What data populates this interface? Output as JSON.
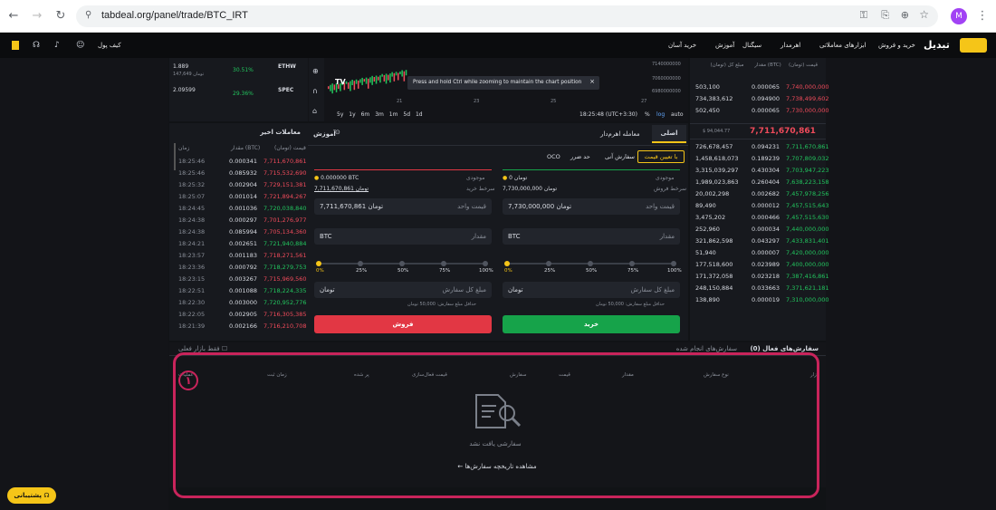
{
  "browser": {
    "url": "tabdeal.org/panel/trade/BTC_IRT",
    "avatar": "M"
  },
  "nav": {
    "logo": "تبدیل",
    "buy_sell": "خرید و فروش",
    "tools": "ابزارهای معاملاتی",
    "leverage": "اهرمدار",
    "signal": "سیگنال",
    "learn": "آموزش",
    "easy": "خرید آسان",
    "wallet": "کیف پول"
  },
  "markets": [
    {
      "name": "ETHW",
      "price": "1.889",
      "sub": "147,649 تومان",
      "change": "30.51%"
    },
    {
      "name": "SPEC",
      "price": "2.09599",
      "sub": "",
      "change": "29.36%"
    }
  ],
  "recent": {
    "title": "معاملات اخیر",
    "headers": [
      "زمان",
      "مقدار (BTC)",
      "قیمت (تومان)"
    ],
    "rows": [
      [
        "18:25:46",
        "0.000341",
        "7,711,670,861",
        "r"
      ],
      [
        "18:25:46",
        "0.085932",
        "7,715,532,690",
        "r"
      ],
      [
        "18:25:32",
        "0.002904",
        "7,729,151,381",
        "r"
      ],
      [
        "18:25:07",
        "0.001014",
        "7,721,894,267",
        "r"
      ],
      [
        "18:24:45",
        "0.001036",
        "7,720,038,840",
        "g"
      ],
      [
        "18:24:38",
        "0.000297",
        "7,701,276,977",
        "r"
      ],
      [
        "18:24:38",
        "0.085994",
        "7,705,134,360",
        "r"
      ],
      [
        "18:24:21",
        "0.002651",
        "7,721,940,884",
        "g"
      ],
      [
        "18:23:57",
        "0.001183",
        "7,718,271,561",
        "r"
      ],
      [
        "18:23:36",
        "0.000792",
        "7,718,279,753",
        "g"
      ],
      [
        "18:23:15",
        "0.003267",
        "7,715,969,560",
        "r"
      ],
      [
        "18:22:51",
        "0.001088",
        "7,718,224,335",
        "g"
      ],
      [
        "18:22:30",
        "0.003000",
        "7,720,952,776",
        "g"
      ],
      [
        "18:22:05",
        "0.002905",
        "7,716,305,385",
        "r"
      ],
      [
        "18:21:39",
        "0.002166",
        "7,716,210,708",
        "r"
      ]
    ]
  },
  "chart": {
    "tooltip": "Press and hold Ctrl while zooming to maintain the chart position",
    "yticks": [
      "7140000000",
      "7060000000",
      "6980000000"
    ],
    "xticks": [
      "21",
      "23",
      "25",
      "27"
    ],
    "ranges": [
      "5y",
      "1y",
      "6m",
      "3m",
      "1m",
      "5d",
      "1d"
    ],
    "time": "18:25:48 (UTC+3:30)",
    "opts": [
      "%",
      "log",
      "auto"
    ]
  },
  "book": {
    "headers": [
      "قیمت (تومان)",
      "مقدار (BTC)",
      "مبلغ کل (تومان)"
    ],
    "asks": [
      [
        "7,740,000,000",
        "0.000065",
        "503,100"
      ],
      [
        "7,738,499,602",
        "0.094900",
        "734,383,612"
      ],
      [
        "7,730,000,000",
        "0.000065",
        "502,450"
      ]
    ],
    "last": "7,711,670,861",
    "last_usd": "$ 94,044.77",
    "bids": [
      [
        "7,711,670,861",
        "0.094231",
        "726,678,457"
      ],
      [
        "7,707,809,032",
        "0.189239",
        "1,458,618,073"
      ],
      [
        "7,703,947,223",
        "0.430304",
        "3,315,039,297"
      ],
      [
        "7,638,223,158",
        "0.260404",
        "1,989,023,863"
      ],
      [
        "7,457,978,256",
        "0.002682",
        "20,002,298"
      ],
      [
        "7,457,515,643",
        "0.000012",
        "89,490"
      ],
      [
        "7,457,515,630",
        "0.000466",
        "3,475,202"
      ],
      [
        "7,440,000,000",
        "0.000034",
        "252,960"
      ],
      [
        "7,433,831,401",
        "0.043297",
        "321,862,598"
      ],
      [
        "7,420,000,000",
        "0.000007",
        "51,940"
      ],
      [
        "7,400,000,000",
        "0.023989",
        "177,518,600"
      ],
      [
        "7,387,416,861",
        "0.023218",
        "171,372,058"
      ],
      [
        "7,371,621,181",
        "0.033663",
        "248,150,884"
      ],
      [
        "7,310,000,000",
        "0.000019",
        "138,890"
      ]
    ]
  },
  "trade": {
    "tab_main": "اصلی",
    "tab_margin": "معامله اهرم‌دار",
    "learn": "آموزش",
    "order_types": [
      "با تعیین قیمت",
      "سفارش آنی",
      "حد ضرر",
      "OCO"
    ],
    "buy": {
      "balance_label": "موجودی",
      "balance": "0 تومان",
      "best_label": "سرخط فروش",
      "best": "7,730,000,000 تومان",
      "price_label": "قیمت واحد",
      "price": "7,730,000,000 تومان",
      "amount_label": "مقدار",
      "asset": "BTC",
      "total_label": "مبلغ کل سفارش",
      "currency": "تومان",
      "min": "حداقل مبلغ سفارش: 50,000 تومان",
      "button": "خرید"
    },
    "sell": {
      "balance_label": "موجودی",
      "balance": "0.000000 BTC",
      "best_label": "سرخط خرید",
      "best": "7,711,670,861 تومان",
      "price_label": "قیمت واحد",
      "price": "7,711,670,861 تومان",
      "amount_label": "مقدار",
      "asset": "BTC",
      "total_label": "مبلغ کل سفارش",
      "currency": "تومان",
      "min": "حداقل مبلغ سفارش: 50,000 تومان",
      "button": "فروش"
    },
    "percents": [
      "0%",
      "25%",
      "50%",
      "75%",
      "100%"
    ]
  },
  "orders": {
    "tab_open": "سفارش‌های فعال (0)",
    "tab_done": "سفارش‌های انجام شده",
    "only_pair": "فقط بازار فعلی",
    "headers": [
      "بازار",
      "نوع سفارش",
      "مقدار",
      "قیمت",
      "سفارش",
      "قیمت فعال‌سازی",
      "پر شده",
      "زمان ثبت",
      "عملیات"
    ],
    "empty": "سفارشی یافت نشد",
    "history": "مشاهده تاریخچه سفارش‌ها",
    "marker": "۱"
  },
  "footer": {
    "support": "پشتیبانی"
  },
  "colors": {
    "buy": "#16a34a",
    "sell": "#e23744",
    "accent": "#f5c518",
    "annotation": "#c9245b"
  }
}
